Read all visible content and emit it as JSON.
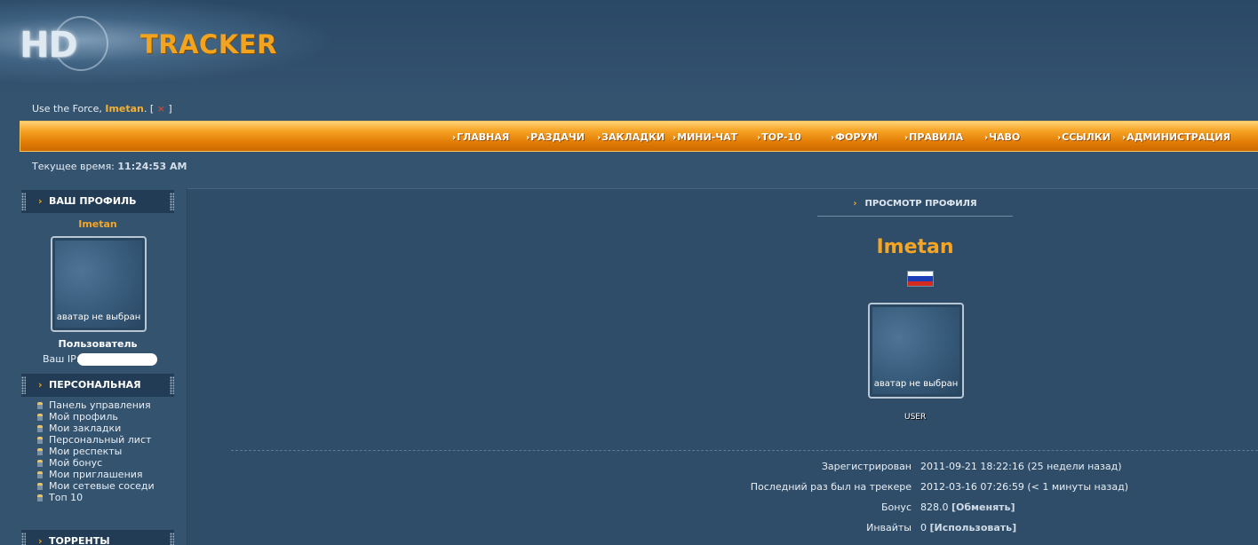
{
  "logo": {
    "part1": "HD",
    "part2": "TRACKER"
  },
  "greeting": {
    "prefix": "Use the Force, ",
    "username": "Imetan",
    "suffix_open": ". [ ",
    "close_symbol": "×",
    "suffix_close": " ]"
  },
  "nav": [
    {
      "label": "ГЛАВНАЯ"
    },
    {
      "label": "РАЗДАЧИ"
    },
    {
      "label": "ЗАКЛАДКИ"
    },
    {
      "label": "МИНИ-ЧАТ"
    },
    {
      "label": "TOP-10"
    },
    {
      "label": "ФОРУМ"
    },
    {
      "label": "ПРАВИЛА"
    },
    {
      "label": "ЧАВО"
    },
    {
      "label": "ССЫЛКИ"
    },
    {
      "label": "АДМИНИСТРАЦИЯ"
    }
  ],
  "clock": {
    "label": "Текущее время: ",
    "time": "11:24:53 AM"
  },
  "sidebar": {
    "profile_head": "ВАШ ПРОФИЛЬ",
    "username": "Imetan",
    "avatar_text": "аватар не выбран",
    "role": "Пользователь",
    "ip_label": "Ваш IP:",
    "personal_head": "ПЕРСОНАЛЬНАЯ",
    "personal_items": [
      "Панель управления",
      "Мой профиль",
      "Мои закладки",
      "Персональный лист",
      "Мои респекты",
      "Мой бонус",
      "Мои приглашения",
      "Мои сетевые соседи",
      "Топ 10"
    ],
    "torrents_head": "ТОРРЕНТЫ"
  },
  "profile": {
    "title": "ПРОСМОТР ПРОФИЛЯ",
    "username": "Imetan",
    "avatar_text": "аватар не выбран",
    "role_badge": "USER",
    "flag_colors": [
      "#ffffff",
      "#1c3fb8",
      "#d52b1e"
    ],
    "rows": [
      {
        "label": "Зарегистрирован",
        "value": "2011-09-21 18:22:16 (25 недели назад)",
        "link": ""
      },
      {
        "label": "Последний раз был на трекере",
        "value": "2012-03-16 07:26:59 (< 1 минуты назад)",
        "link": ""
      },
      {
        "label": "Бонус",
        "value": "828.0 ",
        "link": "[Обменять]"
      },
      {
        "label": "Инвайты",
        "value": "0 ",
        "link": "[Использовать]"
      }
    ]
  },
  "colors": {
    "accent": "#f6a623",
    "background": "#34536f",
    "navbar": "#e8850f"
  }
}
